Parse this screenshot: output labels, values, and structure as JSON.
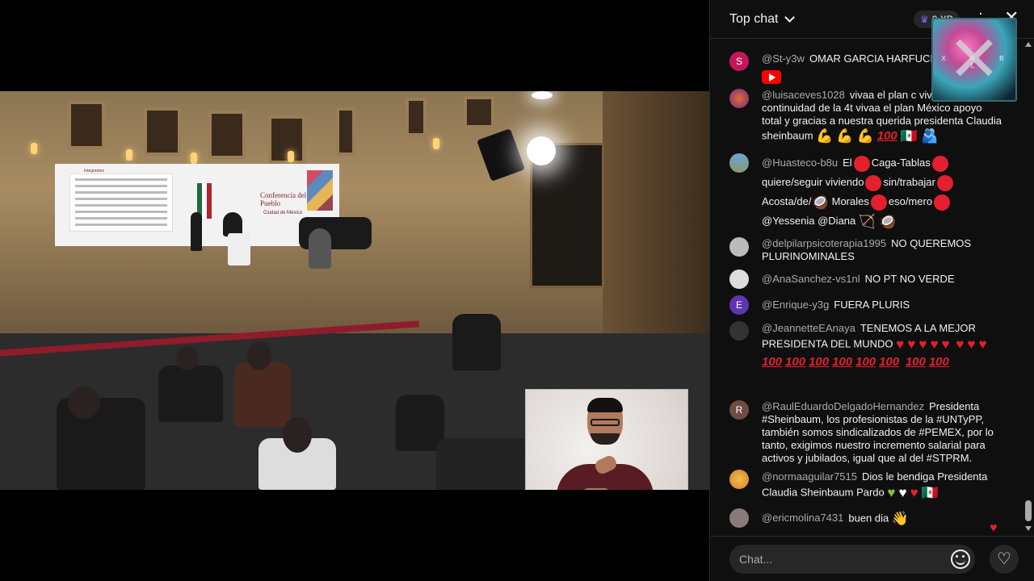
{
  "chat": {
    "header": {
      "title": "Top chat",
      "xp": "0 XP"
    },
    "logo_letters": "X R B L",
    "input_placeholder": "Chat...",
    "messages": [
      {
        "author": "@St-y3w",
        "avatar_letter": "S",
        "avatar_color": "#c2185b",
        "text": "OMAR GARCIA HARFUCH"
      },
      {
        "author": "@luisaceves1028",
        "text": "vivaa el plan c viva la continuidad de la 4t vivaa el plan México apoyo total y gracias a nuestra querida presidenta Claudia sheinbaum"
      },
      {
        "author": "@Huasteco-b8u",
        "parts": [
          "El",
          "Caga-Tablas",
          "quiere/seguir viviendo",
          "sin/trabajar",
          "Acosta/de/",
          "Morales",
          "eso/mero",
          "@Yessenia @Diana"
        ]
      },
      {
        "author": "@delpilarpsicoterapia1995",
        "text": "NO QUEREMOS PLURINOMINALES"
      },
      {
        "author": "@AnaSanchez-vs1nl",
        "text": "NO PT NO VERDE"
      },
      {
        "author": "@Enrique-y3g",
        "avatar_letter": "E",
        "avatar_color": "#5e35b1",
        "text": "FUERA PLURIS"
      },
      {
        "author": "@JeannetteEAnaya",
        "text": "TENEMOS A LA MEJOR PRESIDENTA DEL MUNDO"
      },
      {
        "author": "@RaulEduardoDelgadoHernandez",
        "avatar_letter": "R",
        "avatar_color": "#6d4c41",
        "text": "Presidenta #Sheinbaum, los profesionistas de la #UNTyPP, también somos sindicalizados de #PEMEX, por lo tanto, exigimos nuestro incremento salarial para activos y jubilados, igual que al del #STPRM."
      },
      {
        "author": "@normaaguilar7515",
        "text": "Dios le bendiga Presidenta Claudia Sheinbaum Pardo"
      },
      {
        "author": "@ericmolina7431",
        "text": "buen dia"
      }
    ]
  },
  "video": {
    "banner_header": "Integrantes",
    "banner_title": "Conferencia del Pueblo",
    "banner_sub": "Ciudad de México"
  },
  "icons": {
    "chevron": "chevron-down-icon",
    "crown": "crown-icon",
    "more": "more-vert-icon",
    "close": "close-icon",
    "emoji": "emoji-smile-icon",
    "heart": "heart-icon"
  },
  "colors": {
    "accent_red": "#e5202e",
    "chat_bg": "#0f0f0f",
    "author_gray": "#aaaaaa"
  }
}
